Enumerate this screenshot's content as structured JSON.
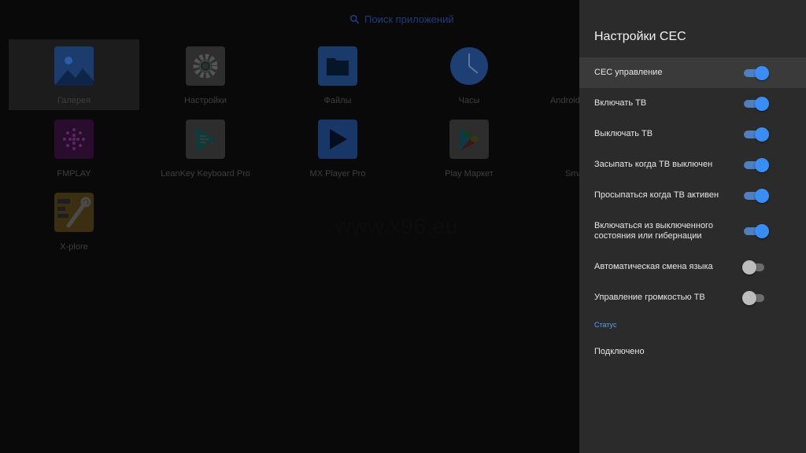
{
  "launcher": {
    "search_placeholder": "Поиск приложений",
    "watermark": "www.x96.eu",
    "apps": [
      {
        "label": "Галерея",
        "icon": "gallery-icon"
      },
      {
        "label": "Настройки",
        "icon": "settings-icon"
      },
      {
        "label": "Файлы",
        "icon": "folder-icon"
      },
      {
        "label": "Часы",
        "icon": "clock-icon"
      },
      {
        "label": "Android",
        "icon": "android-app-icon"
      },
      {
        "label": "FMPLAY",
        "icon": "fmplay-icon"
      },
      {
        "label": "LeanKey Keyboard Pro",
        "icon": "leankey-icon"
      },
      {
        "label": "MX Player Pro",
        "icon": "play-icon"
      },
      {
        "label": "Play Маркет",
        "icon": "play-store-icon"
      },
      {
        "label": "Sma",
        "icon": "smart-app-icon"
      },
      {
        "label": "X-plore",
        "icon": "xplore-icon"
      }
    ]
  },
  "panel": {
    "title": "Настройки CEC",
    "settings": [
      {
        "label": "CEC управление",
        "on": true
      },
      {
        "label": "Включать ТВ",
        "on": true
      },
      {
        "label": "Выключать ТВ",
        "on": true
      },
      {
        "label": "Засыпать когда ТВ выключен",
        "on": true
      },
      {
        "label": "Просыпаться когда ТВ активен",
        "on": true
      },
      {
        "label": "Включаться из выключенного состояния или гибернации",
        "on": true
      },
      {
        "label": "Автоматическая смена языка",
        "on": false
      },
      {
        "label": "Управление громкостью ТВ",
        "on": false
      }
    ],
    "status_header": "Статус",
    "status_value": "Подключено"
  },
  "colors": {
    "panel_bg": "#2b2b2b",
    "accent": "#3a8df5",
    "section_header": "#5aa0f2"
  }
}
